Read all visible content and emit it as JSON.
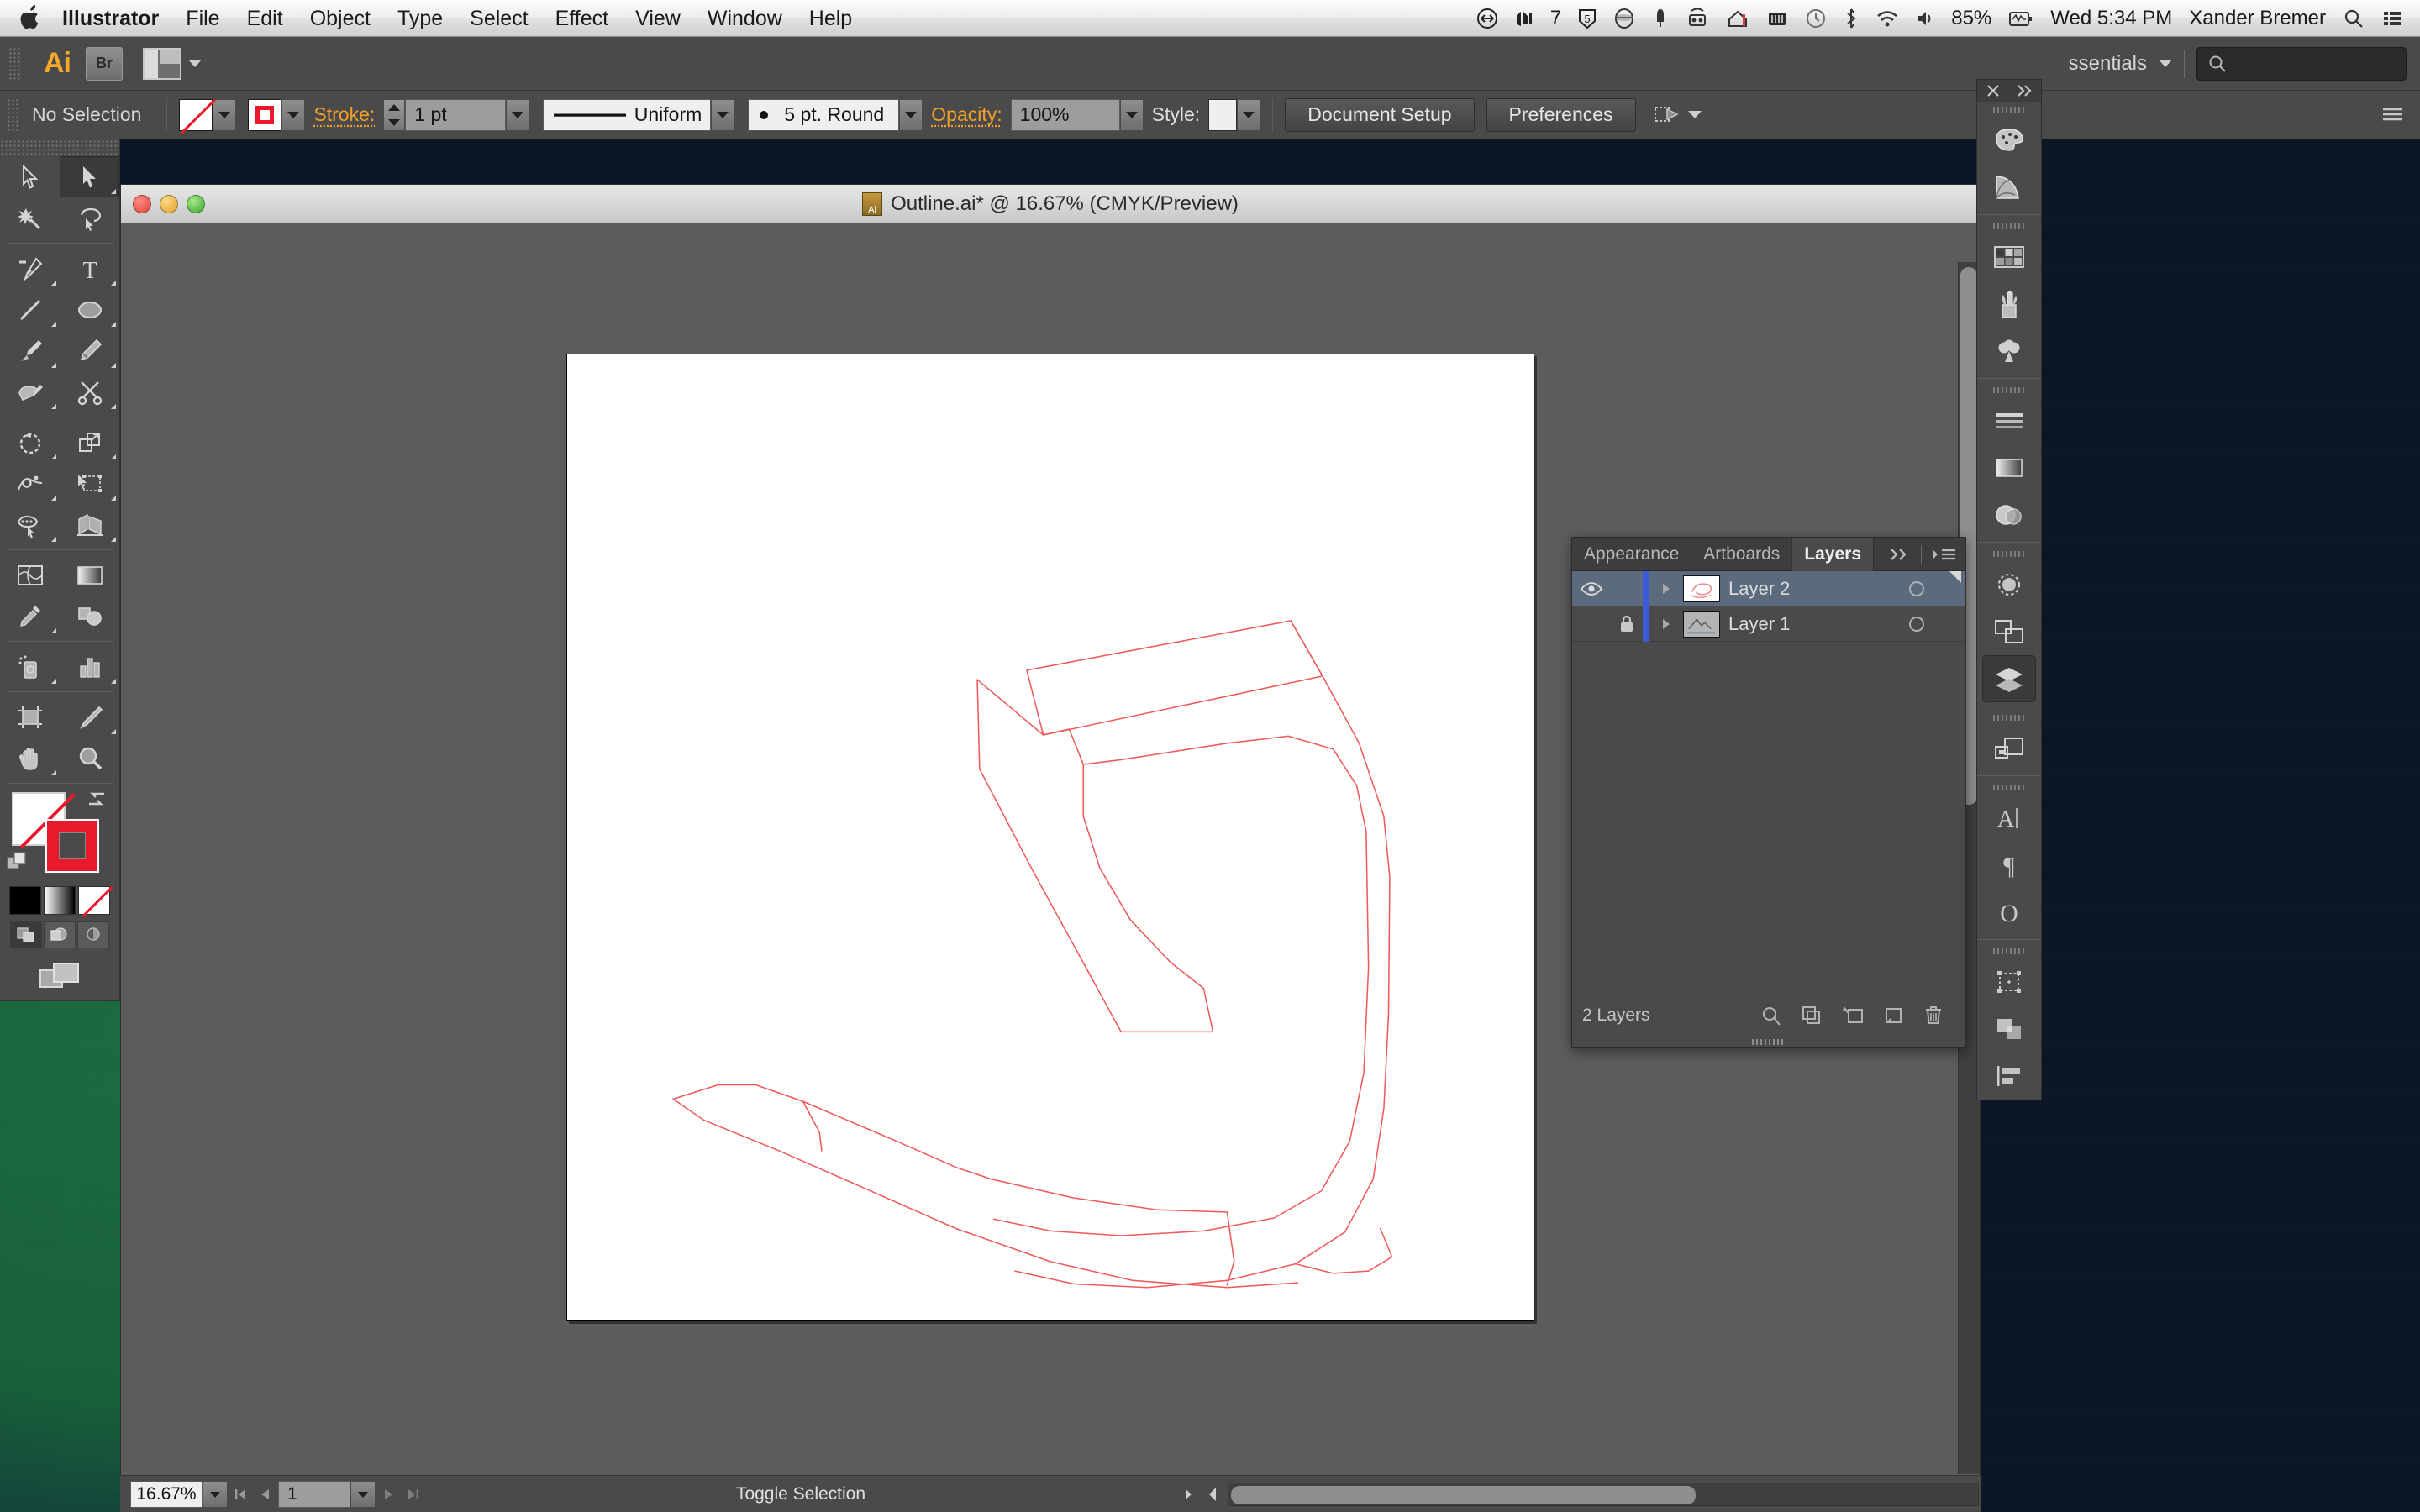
{
  "menubar": {
    "apple_icon": "apple-logo",
    "items": [
      "Illustrator",
      "File",
      "Edit",
      "Object",
      "Type",
      "Select",
      "Effect",
      "View",
      "Window",
      "Help"
    ],
    "status_icons": [
      "arrows-icon",
      "audio-meter-icon",
      "numeral-7",
      "shield-5-icon",
      "dropbox-icon",
      "notification-bell-icon",
      "screen-sharing-icon",
      "backup-icon",
      "battery-meter-icon",
      "time-machine-icon",
      "bluetooth-icon",
      "wifi-icon",
      "volume-icon"
    ],
    "battery": "85%",
    "clock": "Wed 5:34 PM",
    "user": "Xander Bremer",
    "search_icon": "search-icon",
    "list_icon": "notification-center-icon"
  },
  "appbar": {
    "logo": "Ai",
    "bridge_label": "Br",
    "arrange_icon": "arrange-documents-icon",
    "workspace": "ssentials",
    "workspace_caret": "chevron-down-icon",
    "search_icon": "search-icon",
    "search_placeholder": ""
  },
  "controlbar": {
    "selection_status": "No Selection",
    "fill_swatch": "none-fill-swatch",
    "stroke_swatch": "red-stroke-swatch",
    "stroke_label": "Stroke:",
    "stroke_weight": "1 pt",
    "variable_width": "Uniform",
    "brush_definition": "5 pt. Round",
    "opacity_label": "Opacity:",
    "opacity_value": "100%",
    "style_label": "Style:",
    "document_setup": "Document Setup",
    "preferences": "Preferences",
    "transform_icon": "transform-icon"
  },
  "toolbox": {
    "tools": [
      {
        "name": "selection-tool",
        "selected": false
      },
      {
        "name": "direct-selection-tool",
        "selected": true
      },
      {
        "name": "magic-wand-tool",
        "selected": false
      },
      {
        "name": "lasso-tool",
        "selected": false
      },
      {
        "name": "pen-tool",
        "selected": false
      },
      {
        "name": "type-tool",
        "selected": false
      },
      {
        "name": "line-segment-tool",
        "selected": false
      },
      {
        "name": "ellipse-tool",
        "selected": false
      },
      {
        "name": "paintbrush-tool",
        "selected": false
      },
      {
        "name": "pencil-tool",
        "selected": false
      },
      {
        "name": "blob-brush-tool",
        "selected": false
      },
      {
        "name": "scissors-tool",
        "selected": false
      },
      {
        "name": "rotate-tool",
        "selected": false
      },
      {
        "name": "scale-tool",
        "selected": false
      },
      {
        "name": "width-tool",
        "selected": false
      },
      {
        "name": "free-transform-tool",
        "selected": false
      },
      {
        "name": "shape-builder-tool",
        "selected": false
      },
      {
        "name": "perspective-grid-tool",
        "selected": false
      },
      {
        "name": "mesh-tool",
        "selected": false
      },
      {
        "name": "gradient-tool",
        "selected": false
      },
      {
        "name": "eyedropper-tool",
        "selected": false
      },
      {
        "name": "blend-tool",
        "selected": false
      },
      {
        "name": "symbol-sprayer-tool",
        "selected": false
      },
      {
        "name": "column-graph-tool",
        "selected": false
      },
      {
        "name": "artboard-tool",
        "selected": false
      },
      {
        "name": "slice-tool",
        "selected": false
      },
      {
        "name": "hand-tool",
        "selected": false
      },
      {
        "name": "zoom-tool",
        "selected": false
      }
    ],
    "fill_color": "none",
    "stroke_color": "#e8192c",
    "color_modes": [
      "black-color-icon",
      "gradient-icon",
      "none-icon"
    ],
    "drawing_modes": [
      "draw-normal-icon",
      "draw-behind-icon",
      "draw-inside-icon"
    ],
    "screen_mode": "change-screen-mode-icon"
  },
  "document": {
    "title": "Outline.ai* @ 16.67% (CMYK/Preview)",
    "close_button": "close-window-button",
    "minimize_button": "minimize-window-button",
    "zoom_button": "zoom-window-button",
    "file_icon": "illustrator-file-icon"
  },
  "layers_panel": {
    "tabs": [
      {
        "label": "Appearance",
        "active": false
      },
      {
        "label": "Artboards",
        "active": false
      },
      {
        "label": "Layers",
        "active": true
      }
    ],
    "collapse_icon": "double-chevron-right-icon",
    "menu_icon": "panel-menu-icon",
    "layers": [
      {
        "name": "Layer 2",
        "visible": true,
        "locked": false,
        "selected": true,
        "thumb": "artwork-thumbnail"
      },
      {
        "name": "Layer 1",
        "visible": false,
        "locked": true,
        "selected": false,
        "thumb": "template-thumbnail"
      }
    ],
    "count_label": "2 Layers",
    "footer_icons": [
      "locate-object-icon",
      "make-clipping-mask-icon",
      "create-new-sublayer-icon",
      "create-new-layer-icon",
      "delete-selection-icon"
    ]
  },
  "dock": {
    "close_icon": "close-icon",
    "expand_icon": "double-chevron-right-icon",
    "groups": [
      {
        "items": [
          {
            "name": "color-panel-icon",
            "active": false
          },
          {
            "name": "color-guide-panel-icon",
            "active": false
          }
        ]
      },
      {
        "items": [
          {
            "name": "swatches-panel-icon",
            "active": false
          },
          {
            "name": "brushes-panel-icon",
            "active": false
          },
          {
            "name": "symbols-panel-icon",
            "active": false
          }
        ]
      },
      {
        "items": [
          {
            "name": "stroke-panel-icon",
            "active": false
          },
          {
            "name": "gradient-panel-icon",
            "active": false
          },
          {
            "name": "transparency-panel-icon",
            "active": false
          }
        ]
      },
      {
        "items": [
          {
            "name": "appearance-panel-icon",
            "active": false
          },
          {
            "name": "artboards-panel-icon",
            "active": false
          },
          {
            "name": "layers-panel-icon",
            "active": true
          }
        ]
      },
      {
        "items": [
          {
            "name": "links-panel-icon",
            "active": false
          }
        ]
      },
      {
        "items": [
          {
            "name": "character-panel-icon",
            "active": false
          },
          {
            "name": "paragraph-panel-icon",
            "active": false
          },
          {
            "name": "glyphs-panel-icon",
            "active": false
          }
        ]
      },
      {
        "items": [
          {
            "name": "transform-panel-icon",
            "active": false
          },
          {
            "name": "pathfinder-panel-icon",
            "active": false
          },
          {
            "name": "align-panel-icon",
            "active": false
          }
        ]
      }
    ]
  },
  "statusbar": {
    "zoom_level": "16.67%",
    "zoom_caret": "chevron-down-icon",
    "first_page_icon": "first-artboard-icon",
    "prev_page_icon": "previous-artboard-icon",
    "page_number": "1",
    "page_caret": "chevron-down-icon",
    "next_page_icon": "next-artboard-icon",
    "last_page_icon": "last-artboard-icon",
    "status_text": "Toggle Selection",
    "status_caret": "status-menu-icon"
  },
  "artwork": {
    "description": "red-vector-outline-drawing",
    "stroke_color": "#ef5a5a",
    "paths": [
      "M 390 268 L 614 226 L 641 273 L 404 323 Z",
      "M 614 226 L 641 273 L 672 330 L 693 392 L 698 444 L 697 560 L 693 640 L 684 700 L 660 745 L 618 772 L 560 786 L 492 792 L 430 789 L 380 778",
      "M 404 323 L 426 318 L 438 348 L 438 392 L 452 436 L 478 480 L 512 516 L 540 538 L 548 575 L 470 575 L 440 520 L 395 438 L 350 352 L 348 276 Z",
      "M 438 348 L 470 344 L 560 330 L 612 324 L 650 335 L 670 366 L 678 405 L 680 520 L 676 610 L 664 668 L 640 710 L 600 733 L 540 744 L 470 748 L 410 744 L 362 734",
      "M 90 632 L 128 620 L 160 620 L 200 634 L 280 668 L 330 690",
      "M 90 632 L 116 650 L 180 676 L 262 712 L 330 742 L 410 770 L 480 786 L 560 792 L 620 788",
      "M 200 634 L 214 660 L 216 676",
      "M 330 690 L 360 700 L 430 716 L 500 726 L 560 728",
      "M 560 728 L 566 770 L 560 790",
      "M 618 772 L 650 780 L 680 778 L 700 766 L 690 742"
    ]
  }
}
